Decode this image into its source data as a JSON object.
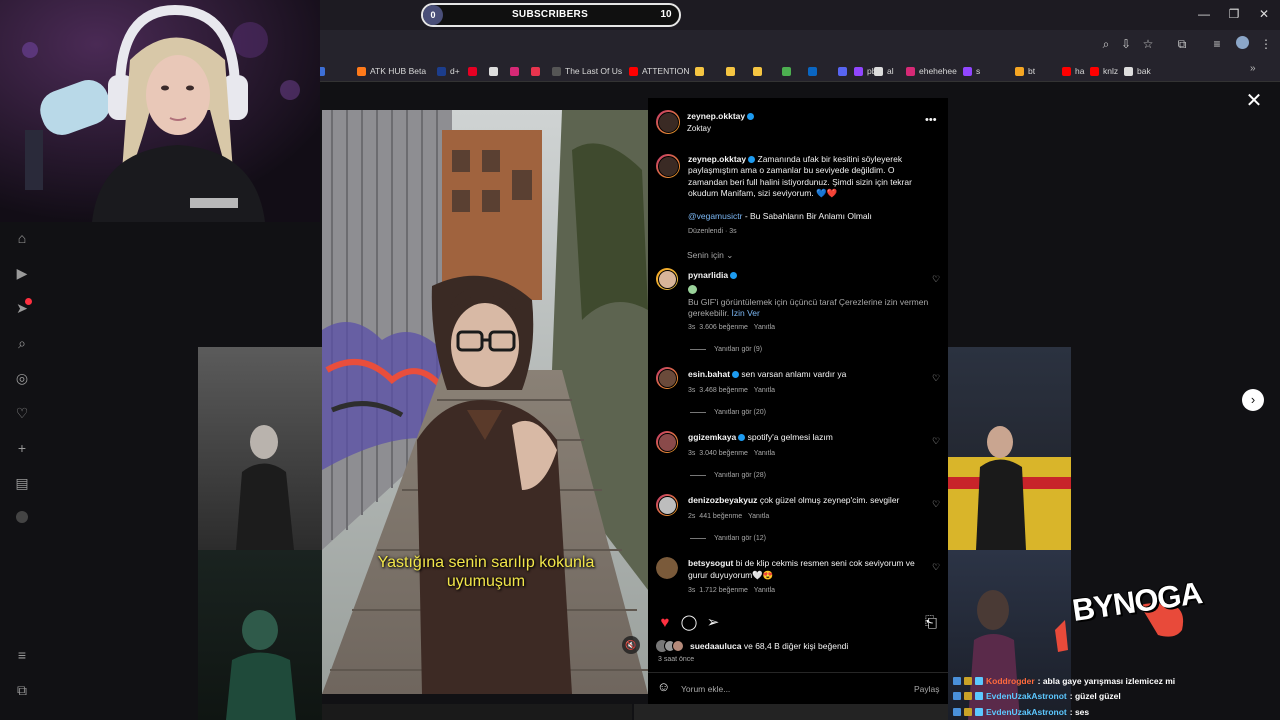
{
  "stream": {
    "subscribers_label": "SUBSCRIBERS",
    "subscribers_current": "0",
    "subscribers_goal": "10",
    "logo": "BYNOGA"
  },
  "browser": {
    "bookmarks": [
      {
        "label": "",
        "color": "#3d6fd6"
      },
      {
        "label": "ATK HUB Beta",
        "color": "#ff7a1a"
      },
      {
        "label": "d+",
        "color": "#1c3d8c"
      },
      {
        "label": "",
        "color": "#e60023"
      },
      {
        "label": "",
        "color": "#dddddd"
      },
      {
        "label": "",
        "color": "#d62976"
      },
      {
        "label": "",
        "color": "#e8344e"
      },
      {
        "label": "The Last Of Us",
        "color": "#555555"
      },
      {
        "label": "ATTENTION",
        "color": "#ff0000"
      },
      {
        "label": "",
        "color": "#f5c542"
      },
      {
        "label": "",
        "color": "#f5c542"
      },
      {
        "label": "",
        "color": "#f5c542"
      },
      {
        "label": "",
        "color": "#4caf50"
      },
      {
        "label": "",
        "color": "#0a66c2"
      },
      {
        "label": "",
        "color": "#5865f2"
      },
      {
        "label": "pb",
        "color": "#9146ff"
      },
      {
        "label": "al",
        "color": "#dddddd"
      },
      {
        "label": "ehehehee",
        "color": "#d62976"
      },
      {
        "label": "s",
        "color": "#9146ff"
      },
      {
        "label": "bt",
        "color": "#f5a623"
      },
      {
        "label": "ha",
        "color": "#ff0000"
      },
      {
        "label": "knlz",
        "color": "#ff0000"
      },
      {
        "label": "bak",
        "color": "#dddddd"
      }
    ]
  },
  "post": {
    "author": "zeynep.okktay",
    "author_subtitle": "Zoktay",
    "caption_user": "zeynep.okktay",
    "caption_text": "Zamanında ufak bir kesitini söyleyerek paylaşmıştım ama o zamanlar bu seviyede değildim. O zamandan beri full halini istiyordunuz. Şimdi sizin için tekrar okudum Manifam, sizi seviyorum. 💙❤️",
    "music_mention": "@vegamusictr",
    "music_title": " - Bu Sabahların Bir Anlamı Olmalı",
    "edited": "Düzenlendi · 3s",
    "sort_label": "Senin için",
    "subtitle_line1": "Yastığına senin sarılıp kokunla",
    "subtitle_line2": "uyumuşum",
    "likes_text": "suedaauluca ve 68,4 B diğer kişi beğendi",
    "liked_by_user": "suedaauluca",
    "likes_rest": " ve 68,4 B diğer kişi beğendi",
    "time_ago": "3 saat önce",
    "comment_placeholder": "Yorum ekle...",
    "share_label": "Paylaş"
  },
  "comments": [
    {
      "user": "pynarlidia",
      "text": "",
      "gif_note": "Bu GIF'i görüntülemek için üçüncü taraf Çerezlerine izin vermen gerekebilir.",
      "gif_link": "İzin Ver",
      "time": "3s",
      "likes": "3.606 beğenme",
      "reply": "Yanıtla",
      "replies": "Yanıtları gör (9)"
    },
    {
      "user": "esin.bahat",
      "text": "sen varsan anlamı vardır ya",
      "time": "3s",
      "likes": "3.468 beğenme",
      "reply": "Yanıtla",
      "replies": "Yanıtları gör (20)"
    },
    {
      "user": "ggizemkaya",
      "text": "spotify'a gelmesi lazım",
      "time": "3s",
      "likes": "3.040 beğenme",
      "reply": "Yanıtla",
      "replies": "Yanıtları gör (28)"
    },
    {
      "user": "denizozbeyakyuz",
      "text": "çok güzel olmuş zeynep'cim. sevgiler",
      "time": "2s",
      "likes": "441 beğenme",
      "reply": "Yanıtla",
      "replies": "Yanıtları gör (12)"
    },
    {
      "user": "betsysogut",
      "text": "bi de klip cekmis resmen seni cok seviyorum ve",
      "text2": "gurur duyuyorum🤍😍",
      "time": "3s",
      "likes": "1.712 beğenme",
      "reply": "Yanıtla"
    }
  ],
  "chat": [
    {
      "user": "Koddrogder",
      "message": ": abla gaye yarışması izlemicez mi",
      "user_color": "#ff6a3d"
    },
    {
      "user": "EvdenUzakAstronot",
      "message": ": güzel güzel",
      "user_color": "#5cc8ff"
    },
    {
      "user": "EvdenUzakAstronot",
      "message": ": ses",
      "user_color": "#5cc8ff"
    }
  ],
  "colors": {
    "accent_heart": "#ff3040",
    "verified": "#1d9bf0",
    "subtitle": "#f2e64a"
  }
}
